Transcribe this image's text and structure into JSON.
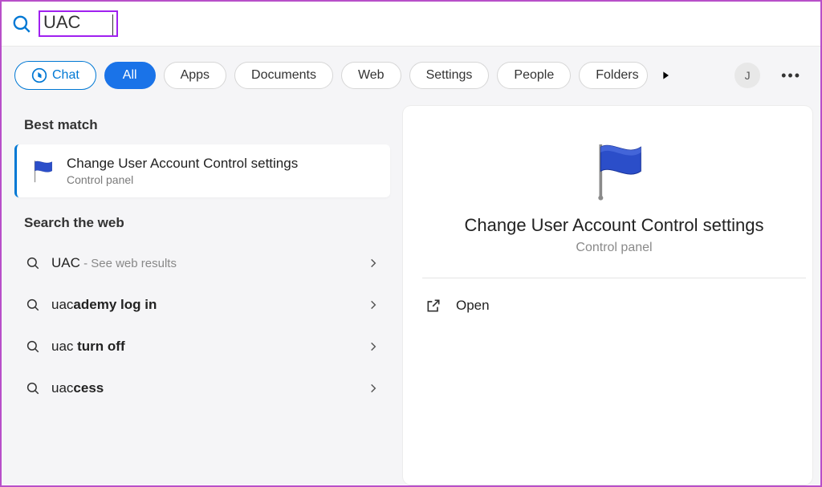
{
  "search": {
    "value": "UAC"
  },
  "tabs": {
    "chat": "Chat",
    "all": "All",
    "apps": "Apps",
    "documents": "Documents",
    "web": "Web",
    "settings": "Settings",
    "people": "People",
    "folders": "Folders"
  },
  "avatar_initial": "J",
  "sections": {
    "best_match": "Best match",
    "search_web": "Search the web"
  },
  "best_match": {
    "title": "Change User Account Control settings",
    "sub": "Control panel"
  },
  "web_results": [
    {
      "prefix": "UAC",
      "bold": "",
      "suffix": " - See web results",
      "suffix_muted": true
    },
    {
      "prefix": "uac",
      "bold": "ademy log in",
      "suffix": "",
      "suffix_muted": false
    },
    {
      "prefix": "uac ",
      "bold": "turn off",
      "suffix": "",
      "suffix_muted": false
    },
    {
      "prefix": "uac",
      "bold": "cess",
      "suffix": "",
      "suffix_muted": false
    }
  ],
  "detail": {
    "title": "Change User Account Control settings",
    "sub": "Control panel",
    "open": "Open"
  }
}
